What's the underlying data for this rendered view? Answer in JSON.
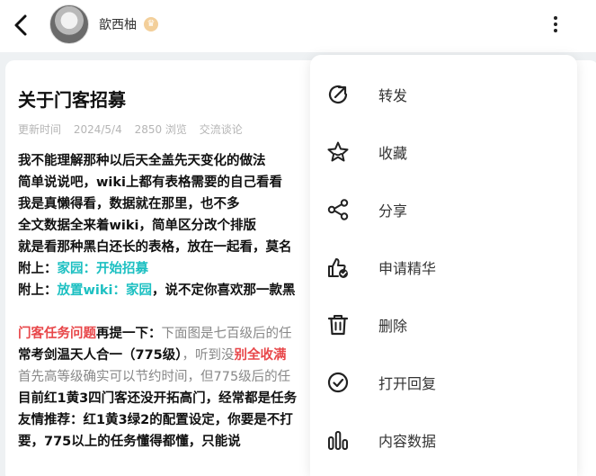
{
  "header": {
    "username": "歆西柚",
    "badge_glyph": "♛"
  },
  "post": {
    "title": "关于门客招募",
    "meta": {
      "label": "更新时间",
      "date": "2024/5/4",
      "views": "2850 浏览",
      "category": "交流谈论"
    },
    "lines": {
      "l1": "我不能理解那种以后天全盖先天变化的做法",
      "l2": "简单说说吧，wiki上都有表格需要的自己看看",
      "l3": "我是真懒得看，数据就在那里，也不多",
      "l4": "全文数据全来着wiki，简单区分改个排版",
      "l5": "就是看那种黑白还长的表格，放在一起看，莫名",
      "l6_prefix": "附上：",
      "l6_link": "家园：开始招募",
      "l7_prefix": "附上：",
      "l7_link": "放置wiki：家园",
      "l7_rest": "，说不定你喜欢那一款黑",
      "l8_red": "门客任务问题",
      "l8_bold": "再提一下：",
      "l8_gray": "下面图是七百级后的任",
      "l9_bold": "常考剑温天人合一（775级）",
      "l9_gray": "，听到没",
      "l9_red": "别全收满",
      "l10": "首先高等级确实可以节约时间，但775级后的任",
      "l11": "目前红1黄3四门客还没开拓高门，经常都是任务",
      "l12": "友情推荐：红1黄3绿2的配置设定，你要是不打",
      "l13": "要，775以上的任务懂得都懂，只能说"
    }
  },
  "menu": {
    "items": [
      {
        "label": "转发",
        "icon": "forward-icon"
      },
      {
        "label": "收藏",
        "icon": "star-icon"
      },
      {
        "label": "分享",
        "icon": "share-icon"
      },
      {
        "label": "申请精华",
        "icon": "thumbs-up-check-icon"
      },
      {
        "label": "删除",
        "icon": "trash-icon"
      },
      {
        "label": "打开回复",
        "icon": "check-circle-icon"
      },
      {
        "label": "内容数据",
        "icon": "bar-chart-icon"
      }
    ]
  }
}
